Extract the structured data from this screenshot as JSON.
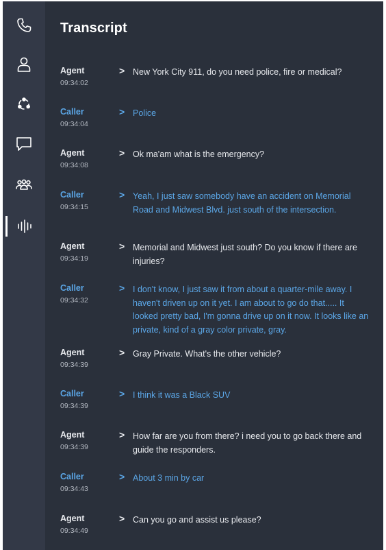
{
  "sidebar": {
    "items": [
      {
        "icon": "phone-icon",
        "label": "Calls"
      },
      {
        "icon": "person-icon",
        "label": "Profile"
      },
      {
        "icon": "network-icon",
        "label": "Network"
      },
      {
        "icon": "chat-icon",
        "label": "Chat"
      },
      {
        "icon": "group-icon",
        "label": "Team"
      },
      {
        "icon": "waveform-icon",
        "label": "Transcript",
        "active": true
      }
    ]
  },
  "main": {
    "title": "Transcript",
    "chevron": ">",
    "entries": [
      {
        "speaker": "Agent",
        "role": "agent",
        "time": "09:34:02",
        "text": "New York City 911, do you need police, fire or medical?"
      },
      {
        "speaker": "Caller",
        "role": "caller",
        "time": "09:34:04",
        "text": "Police"
      },
      {
        "speaker": "Agent",
        "role": "agent",
        "time": "09:34:08",
        "text": "Ok ma'am what is the emergency?"
      },
      {
        "speaker": "Caller",
        "role": "caller",
        "time": "09:34:15",
        "text": "Yeah, I just saw somebody have an accident on Memorial Road and Midwest Blvd. just south of the intersection."
      },
      {
        "speaker": "Agent",
        "role": "agent",
        "time": "09:34:19",
        "text": "Memorial and Midwest just south? Do you know if there are injuries?"
      },
      {
        "speaker": "Caller",
        "role": "caller",
        "time": "09:34:32",
        "text": "I don't know, I just saw it from about a quarter-mile away. I haven't driven up on it yet.  I am about to go do that..... It looked pretty bad, I'm gonna drive up on it now.  It looks like an private, kind of a gray color private, gray."
      },
      {
        "speaker": "Agent",
        "role": "agent",
        "time": "09:34:39",
        "text": "Gray Private. What's the other vehicle?"
      },
      {
        "speaker": "Caller",
        "role": "caller",
        "time": "09:34:39",
        "text": "I think it was a Black SUV"
      },
      {
        "speaker": "Agent",
        "role": "agent",
        "time": "09:34:39",
        "text": "How far are you from there? i need you to go back there and guide the responders."
      },
      {
        "speaker": "Caller",
        "role": "caller",
        "time": "09:34:43",
        "text": "About 3 min by car"
      },
      {
        "speaker": "Agent",
        "role": "agent",
        "time": "09:34:49",
        "text": "Can you go and assist us please?"
      }
    ]
  }
}
